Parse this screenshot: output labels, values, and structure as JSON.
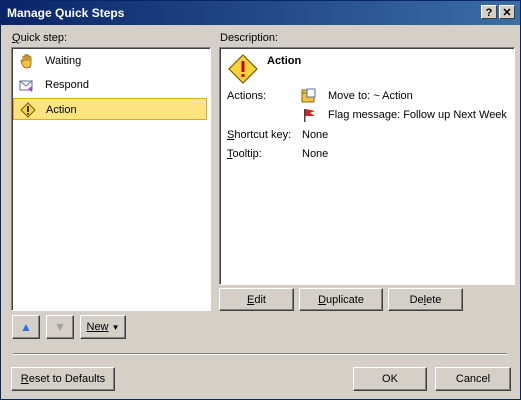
{
  "window": {
    "title": "Manage Quick Steps",
    "help_label": "?",
    "close_label": "✕"
  },
  "quickstep": {
    "label": "Quick step:",
    "items": [
      {
        "label": "Waiting",
        "icon": "hand-icon"
      },
      {
        "label": "Respond",
        "icon": "envelope-reply-icon"
      },
      {
        "label": "Action",
        "icon": "warning-icon",
        "selected": true
      }
    ],
    "move_up_label": "▲",
    "move_down_label": "▼",
    "new_label": "New",
    "new_arrow": "▼"
  },
  "description": {
    "label": "Description:",
    "name": "Action",
    "actions_label": "Actions:",
    "actions": [
      {
        "text": "Move to: ~ Action",
        "icon": "move-folder-icon"
      },
      {
        "text": "Flag message: Follow up Next Week",
        "icon": "red-flag-icon"
      }
    ],
    "shortcut_label": "Shortcut key:",
    "shortcut_value": "None",
    "tooltip_label": "Tooltip:",
    "tooltip_value": "None"
  },
  "buttons": {
    "edit": "Edit",
    "duplicate": "Duplicate",
    "delete": "Delete",
    "reset": "Reset to Defaults",
    "ok": "OK",
    "cancel": "Cancel"
  }
}
